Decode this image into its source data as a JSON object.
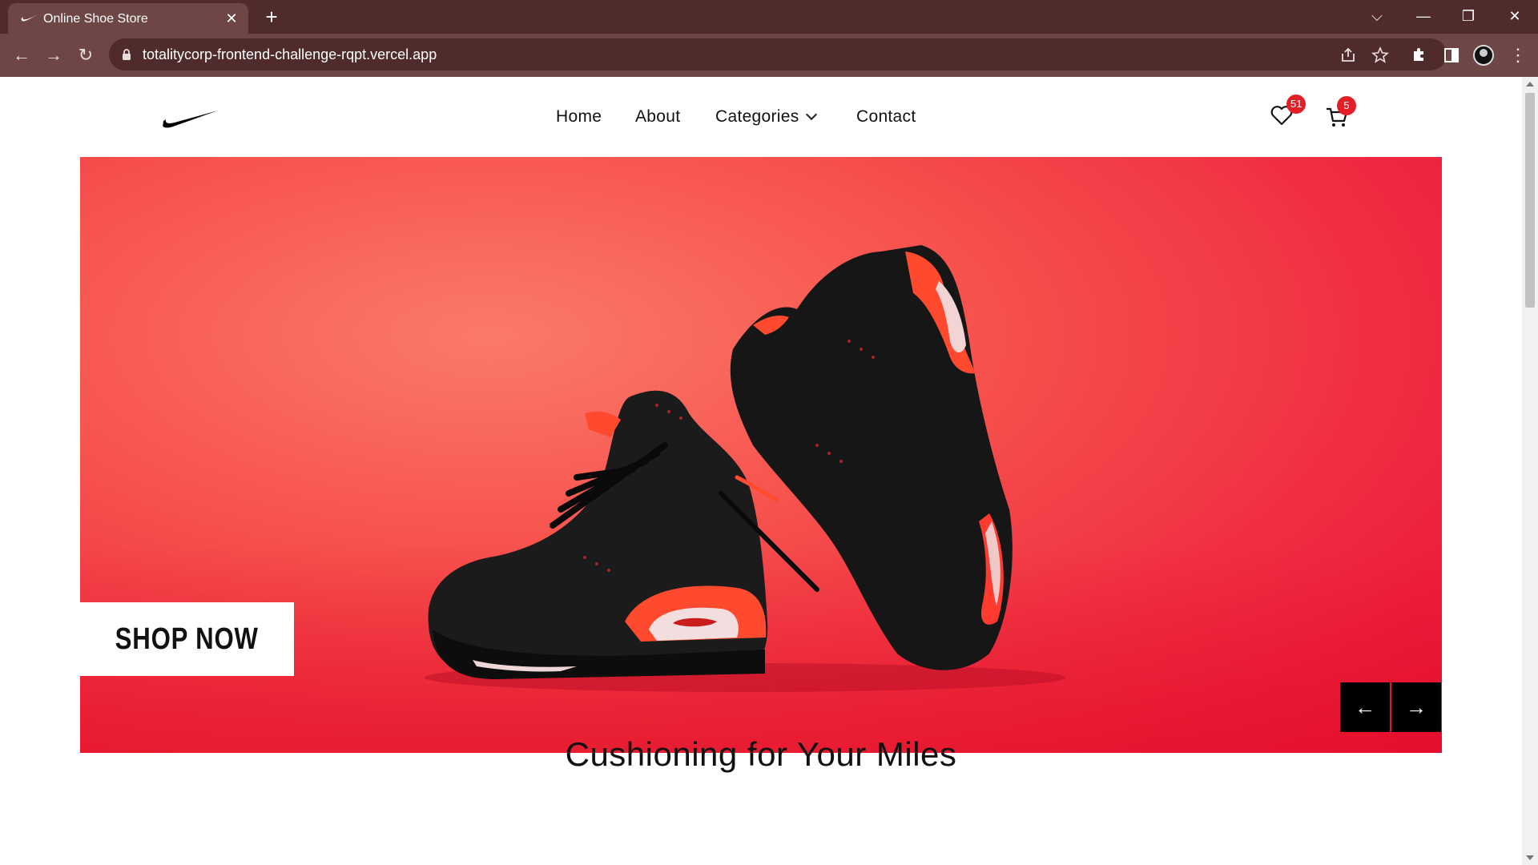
{
  "browser": {
    "tab_title": "Online Shoe Store",
    "tab_close": "✕",
    "new_tab": "+",
    "url": "totalitycorp-frontend-challenge-rqpt.vercel.app",
    "controls": {
      "tab_search": "⌵",
      "minimize": "—",
      "restore": "❐",
      "close": "✕"
    },
    "nav": {
      "back": "←",
      "forward": "→",
      "reload": "↻"
    },
    "omnibox_icons": [
      "share-icon",
      "bookmark-star-icon"
    ],
    "toolbar_icons": [
      "extensions-icon",
      "side-panel-icon",
      "profile-avatar",
      "menu-icon"
    ]
  },
  "header": {
    "nav_items": [
      "Home",
      "About",
      "Categories",
      "Contact"
    ],
    "wishlist_count": "51",
    "cart_count": "5"
  },
  "hero": {
    "cta_label": "SHOP NOW",
    "prev_label": "←",
    "next_label": "→"
  },
  "section": {
    "title": "Cushioning for Your Miles"
  },
  "colors": {
    "chrome_dark": "#4f2b2b",
    "chrome_mid": "#6e4646",
    "hero_red": "#f03042",
    "badge_red": "#e41e26"
  }
}
